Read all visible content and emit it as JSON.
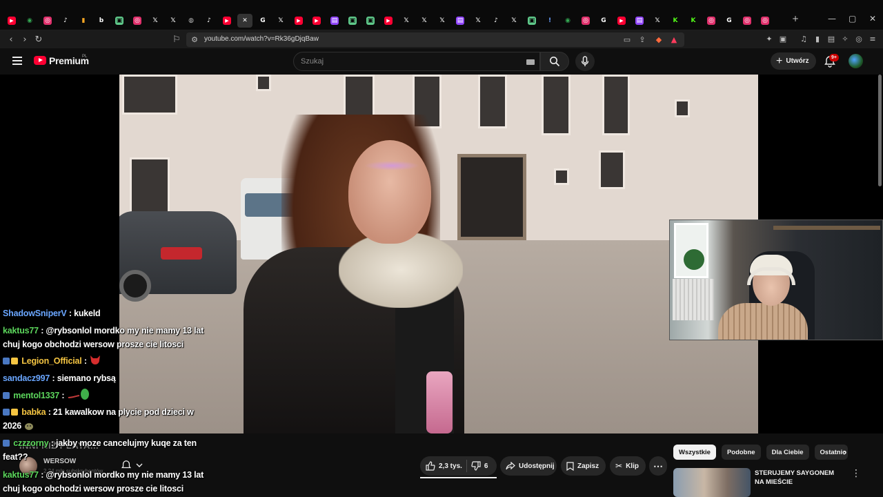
{
  "browser": {
    "tabs": [
      {
        "icon": "youtube-icon",
        "color": "#ff0033"
      },
      {
        "icon": "maps-icon",
        "color": "#34a853"
      },
      {
        "icon": "instagram-icon",
        "color": "#e1306c"
      },
      {
        "icon": "tiktok-icon",
        "color": "#ffffff"
      },
      {
        "icon": "bookmark-icon",
        "color": "#f5a623"
      },
      {
        "icon": "b-icon",
        "color": "#ffffff"
      },
      {
        "icon": "chat-icon",
        "color": "#5fc98a"
      },
      {
        "icon": "instagram-icon",
        "color": "#e1306c"
      },
      {
        "icon": "x-icon",
        "color": "#ffffff"
      },
      {
        "icon": "x-icon",
        "color": "#ffffff"
      },
      {
        "icon": "globe-icon",
        "color": "#bbbbbb"
      },
      {
        "icon": "tiktok-icon",
        "color": "#ffffff"
      },
      {
        "icon": "youtube-icon",
        "color": "#ff0033"
      },
      {
        "icon": "close-icon",
        "color": "#ffffff",
        "active": true
      },
      {
        "icon": "google-icon",
        "color": "#ffffff"
      },
      {
        "icon": "x-icon",
        "color": "#ffffff"
      },
      {
        "icon": "youtube-icon",
        "color": "#ff0033"
      },
      {
        "icon": "youtube-icon",
        "color": "#ff0033"
      },
      {
        "icon": "twitch-icon",
        "color": "#9146ff"
      },
      {
        "icon": "chat-icon",
        "color": "#5fc98a"
      },
      {
        "icon": "chat-icon",
        "color": "#5fc98a"
      },
      {
        "icon": "youtube-icon",
        "color": "#ff0033"
      },
      {
        "icon": "x-icon",
        "color": "#ffffff"
      },
      {
        "icon": "x-icon",
        "color": "#ffffff"
      },
      {
        "icon": "x-icon",
        "color": "#ffffff"
      },
      {
        "icon": "twitch-icon",
        "color": "#9146ff"
      },
      {
        "icon": "x-icon",
        "color": "#ffffff"
      },
      {
        "icon": "tiktok-icon",
        "color": "#ffffff"
      },
      {
        "icon": "x-icon",
        "color": "#ffffff"
      },
      {
        "icon": "chat-icon",
        "color": "#5fc98a"
      },
      {
        "icon": "exclamation-icon",
        "color": "#6aa0ff"
      },
      {
        "icon": "maps-icon",
        "color": "#34a853"
      },
      {
        "icon": "instagram-icon",
        "color": "#e1306c"
      },
      {
        "icon": "google-icon",
        "color": "#ffffff"
      },
      {
        "icon": "youtube-icon",
        "color": "#ff0033"
      },
      {
        "icon": "twitch-icon",
        "color": "#9146ff"
      },
      {
        "icon": "x-icon",
        "color": "#ffffff"
      },
      {
        "icon": "kick-icon",
        "color": "#53fc18"
      },
      {
        "icon": "kick-icon",
        "color": "#53fc18"
      },
      {
        "icon": "instagram-icon",
        "color": "#e1306c"
      },
      {
        "icon": "google-icon",
        "color": "#ffffff"
      },
      {
        "icon": "instagram-icon",
        "color": "#e1306c"
      },
      {
        "icon": "instagram-icon",
        "color": "#e1306c"
      }
    ],
    "url": "youtube.com/watch?v=Rk36gDjqBaw"
  },
  "header": {
    "brand": "Premium",
    "brand_country": "PL",
    "search_placeholder": "Szukaj",
    "create_label": "Utwórz",
    "notifications_badge": "9+"
  },
  "chat": {
    "messages": [
      {
        "user": "ShadowSniperV",
        "color": "#6aa6ff",
        "text": " : kukeld"
      },
      {
        "user": "kaktus77",
        "color": "#5cd65c",
        "text": " : @rybsonlol mordko my nie mamy 13 lat chuj kogo obchodzi wersow prosze cie litosci"
      },
      {
        "user": "Legion_Official",
        "color": "#f5c542",
        "text": " : ",
        "badges": true
      },
      {
        "user": "sandacz997",
        "color": "#6aa6ff",
        "text": " : siemano rybsą"
      },
      {
        "user": "mentol1337",
        "color": "#5cd65c",
        "text": " : ",
        "badges": true
      },
      {
        "user": "babka",
        "color": "#f5c542",
        "text": " : 21 kawalkow na plycie pod dzieci w 2026",
        "badges": true
      },
      {
        "user": "czzzorny",
        "color": "#5cd65c",
        "text": " : jakby moze cancelujmy kuqe za ten feat??",
        "badges": true
      },
      {
        "user": "kaktus77",
        "color": "#5cd65c",
        "text": " : @rybsonlol mordko my nie mamy 13 lat chuj kogo obchodzi wersow prosze cie litosci"
      }
    ]
  },
  "below": {
    "title_ghost": "INNI NIŻ PLAYA...",
    "channel_name": "WERSOW",
    "subs": "2,24 mln subskrybentów",
    "likes": "2,3 tys.",
    "dislikes": "6",
    "share_label": "Udostępnij",
    "save_label": "Zapisz",
    "clip_label": "Klip",
    "chips": [
      "Wszystkie",
      "Podobne",
      "Dla Ciebie",
      "Ostatnio"
    ],
    "rec_title": "STERUJEMY SAYGONEM NA MIEŚCIE"
  }
}
